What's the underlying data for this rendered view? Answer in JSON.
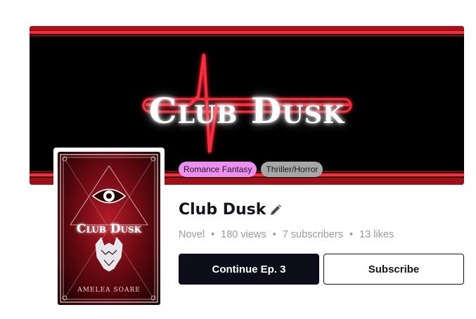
{
  "banner": {
    "title": "Club Dusk",
    "accent_color": "#ff1a2e"
  },
  "tags": [
    {
      "label": "Romance Fantasy",
      "color": "#ec8ff0"
    },
    {
      "label": "Thriller/Horror",
      "color": "#a7a7a7"
    }
  ],
  "cover": {
    "title": "Club Dusk",
    "author": "AMELEA SOARE",
    "icons": [
      "eye-icon",
      "wolf-icon"
    ]
  },
  "series": {
    "title": "Club Dusk",
    "edit_icon": "pencil-icon"
  },
  "meta": {
    "type": "Novel",
    "views": "180 views",
    "subscribers": "7 subscribers",
    "likes": "13 likes",
    "separator": "•"
  },
  "actions": {
    "continue_label": "Continue Ep. 3",
    "subscribe_label": "Subscribe"
  }
}
